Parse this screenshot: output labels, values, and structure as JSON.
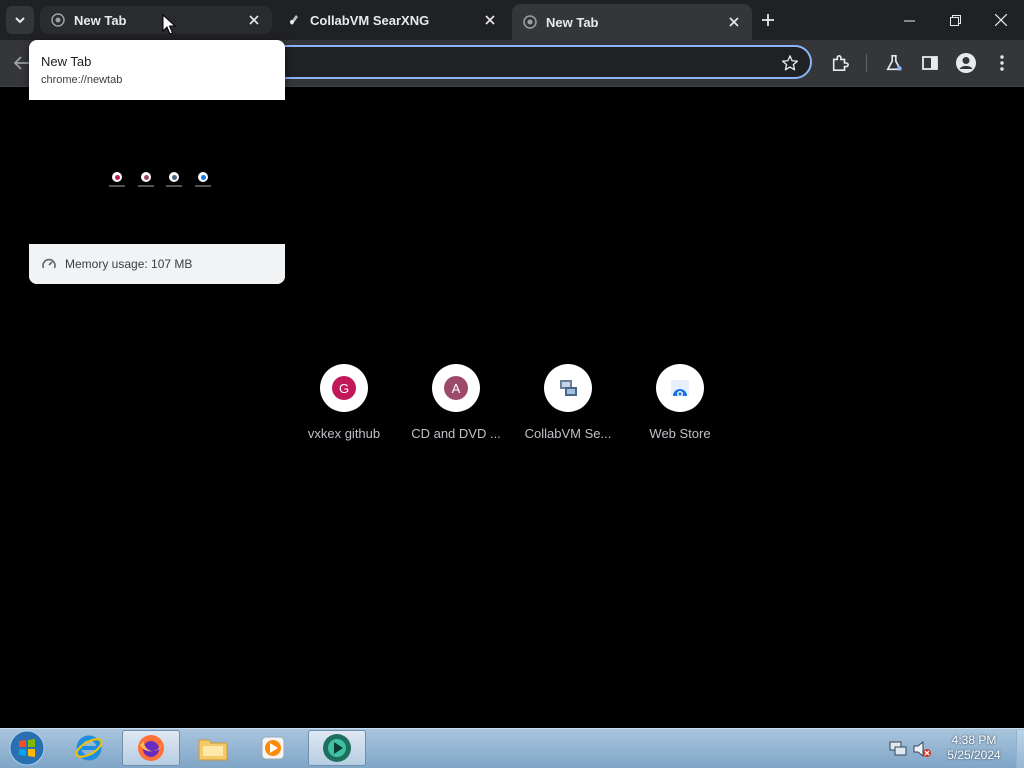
{
  "tabs": [
    {
      "title": "New Tab",
      "favicon": "globe-icon"
    },
    {
      "title": "CollabVM SearXNG",
      "favicon": "searxng-icon"
    },
    {
      "title": "New Tab",
      "favicon": "globe-icon"
    }
  ],
  "hover_card": {
    "title": "New Tab",
    "url": "chrome://newtab",
    "memory": "Memory usage: 107 MB"
  },
  "shortcuts": [
    {
      "label": "vxkex github",
      "letter": "G",
      "color": "#c2185b"
    },
    {
      "label": "CD and DVD ...",
      "letter": "A",
      "color": "#9c4a6a"
    },
    {
      "label": "CollabVM Se...",
      "icon": "collabvm-icon"
    },
    {
      "label": "Web Store",
      "icon": "webstore-icon"
    }
  ],
  "clock": {
    "time": "4:38 PM",
    "date": "5/25/2024"
  },
  "colors": {
    "accent": "#8ab4f8",
    "tabstrip": "#202124",
    "toolbar": "#35363a"
  }
}
